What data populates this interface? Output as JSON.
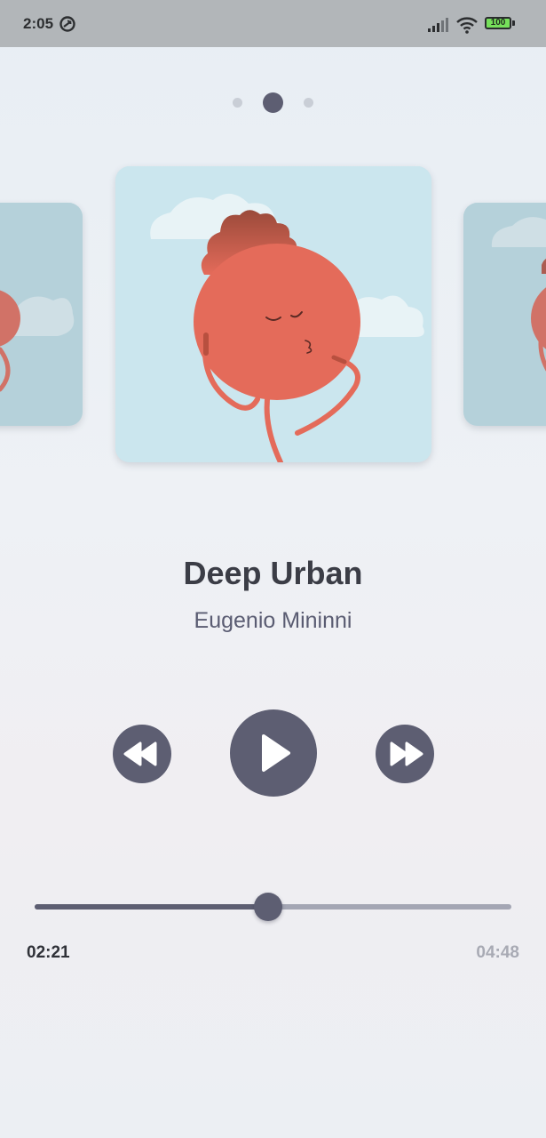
{
  "status_bar": {
    "time": "2:05",
    "battery": "100",
    "icons": [
      "data-saver-icon",
      "signal-icon",
      "wifi-icon",
      "battery-icon"
    ]
  },
  "pager": {
    "count": 3,
    "active_index": 1
  },
  "carousel": {
    "cards": [
      {
        "art": "red-character-artwork",
        "position": "previous"
      },
      {
        "art": "red-character-artwork",
        "position": "current"
      },
      {
        "art": "red-character-artwork",
        "position": "next"
      }
    ]
  },
  "track": {
    "title": "Deep Urban",
    "artist": "Eugenio Mininni"
  },
  "controls": {
    "rewind_icon": "rewind-icon",
    "play_icon": "play-icon",
    "forward_icon": "fast-forward-icon"
  },
  "progress": {
    "current_time": "02:21",
    "total_time": "04:48",
    "fraction": 0.49
  },
  "colors": {
    "accent": "#5d5e72",
    "title": "#3b3d46",
    "artist": "#5a5c72",
    "track_inactive": "#a4a6b4",
    "art_background": "#cbe6ee",
    "character": "#e46b5a"
  }
}
